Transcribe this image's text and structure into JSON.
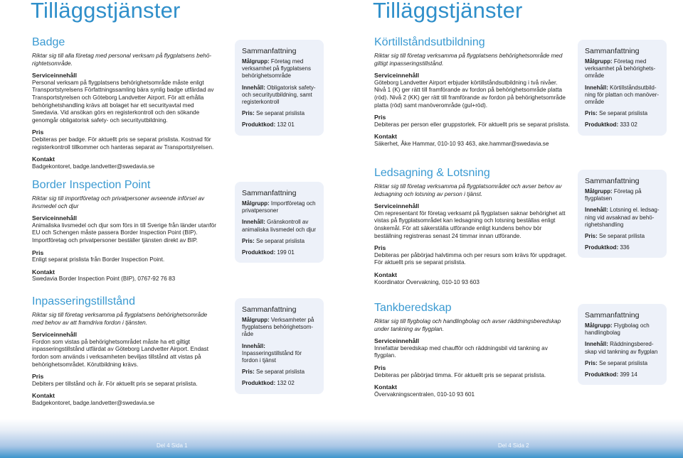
{
  "colors": {
    "accent": "#2f8fca",
    "summary_bg": "#edf1f9",
    "footer_blue": "#3d94cc"
  },
  "pages": [
    {
      "title": "Tilläggstjänster",
      "footer": "Del 4 Sida 1",
      "sections": [
        {
          "title": "Badge",
          "intro": "Riktar sig till alla företag med personal verksam på flygplatsens behö-rightetsområde.",
          "service_head": "Serviceinnehåll",
          "service_text": "Personal verksam på flygplatsens behörighetsområde måste enligt Transportstyrelsens Författningssamling bära synlig badge utfärdad av Transportstyrelsen och Göteborg Landvetter Airport. För att erhålla behörighetshandling krävs att bolaget har ett securityavtal med Swedavia. Vid ansökan görs en registerkontroll och den sökande genomgår obligatorisk safety- och securityutbildning.",
          "price_head": "Pris",
          "price_text": "Debiteras per badge. För aktuellt pris se separat prislista. Kostnad för registerkontroll tillkommer och hanteras separat av Transportstyrelsen.",
          "contact_head": "Kontakt",
          "contact_text": "Badgekontoret, badge.landvetter@swedavia.se",
          "summary": {
            "title": "Sammanfattning",
            "target_label": "Målgrupp:",
            "target": "Företag med verksamhet på flygplatsens behörighetsområde",
            "content_label": "Innehåll:",
            "content": "Obligatorisk safety- och securityutbildning, samt registerkontroll",
            "price_label": "Pris:",
            "price": "Se separat prislista",
            "code_label": "Produktkod:",
            "code": "132 01"
          }
        },
        {
          "title": "Border Inspection Point",
          "intro": "Riktar sig till importföretag och privatpersoner avseende införsel av livsmedel och djur",
          "service_head": "Serviceinnehåll",
          "service_text": "Animaliska livsmedel och djur som förs in till Sverige från länder utanför EU och Schengen måste passera Border Inspection Point (BIP). Importföretag och privatpersoner beställer tjänsten direkt av BIP.",
          "price_head": "Pris",
          "price_text": "Enligt separat prislista från Border Inspection Point.",
          "contact_head": "Kontakt",
          "contact_text": "Swedavia Border Inspection Point (BIP), 0767-92 76 83",
          "summary": {
            "title": "Sammanfattning",
            "target_label": "Målgrupp:",
            "target": "Importföretag och privatpersoner",
            "content_label": "Innehåll:",
            "content": "Gränskontroll av animaliska livsmedel och djur",
            "price_label": "Pris:",
            "price": "Se separat prislista",
            "code_label": "Produktkod:",
            "code": "199 01"
          }
        },
        {
          "title": "Inpasseringstillstånd",
          "intro": "Riktar sig till företag verksamma på flygplatsens behörighetsområde med behov av att framdriva fordon i tjänsten.",
          "service_head": "Serviceinnehåll",
          "service_text": "Fordon som vistas på behörighetsområdet måste ha ett giltigt inpasseringstillstånd utfärdat av Göteborg Landvetter Airport. Endast fordon som används i verksamheten beviljas tillstånd att vistas på behörighetsområdet. Körutbildning krävs.",
          "price_head": "Pris",
          "price_text": "Debiters per  tillstånd och år. För aktuellt pris se separat prislista.",
          "contact_head": "Kontakt",
          "contact_text": "Badgekontoret, badge.landvetter@swedavia.se",
          "summary": {
            "title": "Sammanfattning",
            "target_label": "Målgrupp:",
            "target": "Verksamheter på flygplatsens behörighetsom-råde",
            "content_label": "Innehåll:",
            "content": "Inpasseringstillstånd för fordon i tjänst",
            "price_label": "Pris:",
            "price": "Se separat prislista",
            "code_label": "Produktkod:",
            "code": "132 02"
          }
        }
      ]
    },
    {
      "title": "Tilläggstjänster",
      "footer": "Del 4 Sida 2",
      "sections": [
        {
          "title": "Körtillståndsutbildning",
          "intro": "Riktar sig till företag verksamma på flygplatsens behörighetsområde med giltigt inpasseringstillstånd.",
          "service_head": "Serviceinnehåll",
          "service_text": "Göteborg Landvetter Airport erbjuder körtillståndsutbildning i två nivåer. Nivå 1 (K) ger rätt till framförande av fordon på behörighetsområde platta (röd). Nivå 2 (KK) ger rätt till framförande av fordon på behörighetsområde platta (röd) samt manöverområde (gul+röd).",
          "price_head": "Pris",
          "price_text": "Debiteras per person eller gruppstorlek. För aktuellt pris se separat prislista.",
          "contact_head": "Kontakt",
          "contact_text": "Säkerhet, Åke Hammar, 010-10 93 463, ake.hammar@swedavia.se",
          "summary": {
            "title": "Sammanfattning",
            "target_label": "Målgrupp:",
            "target": "Företag med verksamhet på behörighets-område",
            "content_label": "Innehåll:",
            "content": "Körtillståndsutbild-ning för plattan och manöver-område",
            "price_label": "Pris:",
            "price": "Se separat prislista",
            "code_label": "Produktkod:",
            "code": "333 02"
          }
        },
        {
          "title": "Ledsagning & Lotsning",
          "intro": "Riktar sig till företag verksamma på flygplatsområdet och avser behov av ledsagning och lotsning av person i tjänst.",
          "service_head": "Serviceinnehåll",
          "service_text": "Om representant för företag verksamt på flygplatsen saknar behörighet att vistas på flygplatsområdet kan ledsagning och lotsning beställas enligt önskemål. För att säkerställa utförande enligt kundens behov bör beställning registreras senast 24 timmar innan utförande.",
          "price_head": "Pris",
          "price_text": "Debiteras per påbörjad halvtimma och per resurs som krävs för uppdraget. För aktuellt pris se separat prislista.",
          "contact_head": "Kontakt",
          "contact_text": "Koordinator Övervakning, 010-10 93 603",
          "summary": {
            "title": "Sammanfattning",
            "target_label": "Målgrupp:",
            "target": "Företag på flygplatsen",
            "content_label": "Innehåll:",
            "content": "Lotsning el. ledsag-ning vid avsaknad av behö-righetshandling",
            "price_label": "Pris:",
            "price": "Se separat prilista",
            "code_label": "Produktkod:",
            "code": "336"
          }
        },
        {
          "title": "Tankberedskap",
          "intro": "Riktar sig till flygbolag och handlingbolag och avser räddningsberedskap under tankning av flygplan.",
          "service_head": "Serviceinnehåll",
          "service_text": "Innefattar beredskap med chaufför och räddningsbil vid tankning av flygplan.",
          "price_head": "Pris",
          "price_text": "Debiteras per påbörjad timma. För aktuellt pris se separat prislista.",
          "contact_head": "Kontakt",
          "contact_text": "Övervakningscentralen, 010-10 93 601",
          "summary": {
            "title": "Sammanfattning",
            "target_label": "Målgrupp:",
            "target": "Flygbolag och handlingbolag",
            "content_label": "Innehåll:",
            "content": "Räddningsbered-skap vid tankning av flygplan",
            "price_label": "Pris:",
            "price": "Se separat prislista",
            "code_label": "Produktkod:",
            "code": "399 14"
          }
        }
      ]
    }
  ]
}
